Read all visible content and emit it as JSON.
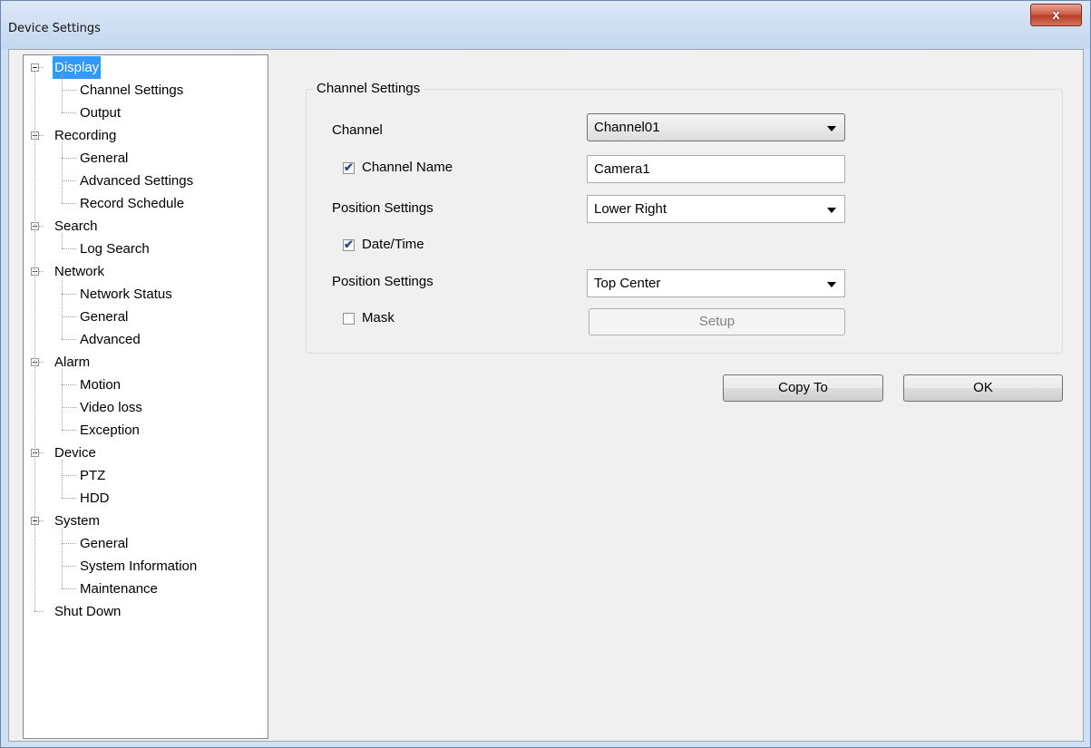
{
  "window": {
    "title": "Device Settings",
    "close_label": "x"
  },
  "tree": {
    "nodes": [
      {
        "label": "Display",
        "level": 0,
        "expanded": true,
        "selected": true
      },
      {
        "label": "Channel Settings",
        "level": 1
      },
      {
        "label": "Output",
        "level": 1
      },
      {
        "label": "Recording",
        "level": 0,
        "expanded": true
      },
      {
        "label": "General",
        "level": 1
      },
      {
        "label": "Advanced Settings",
        "level": 1
      },
      {
        "label": "Record Schedule",
        "level": 1
      },
      {
        "label": "Search",
        "level": 0,
        "expanded": true
      },
      {
        "label": "Log Search",
        "level": 1
      },
      {
        "label": "Network",
        "level": 0,
        "expanded": true
      },
      {
        "label": "Network Status",
        "level": 1
      },
      {
        "label": "General",
        "level": 1
      },
      {
        "label": "Advanced",
        "level": 1
      },
      {
        "label": "Alarm",
        "level": 0,
        "expanded": true
      },
      {
        "label": "Motion",
        "level": 1
      },
      {
        "label": "Video loss",
        "level": 1
      },
      {
        "label": "Exception",
        "level": 1
      },
      {
        "label": "Device",
        "level": 0,
        "expanded": true
      },
      {
        "label": "PTZ",
        "level": 1
      },
      {
        "label": "HDD",
        "level": 1
      },
      {
        "label": "System",
        "level": 0,
        "expanded": true
      },
      {
        "label": "General",
        "level": 1
      },
      {
        "label": "System Information",
        "level": 1
      },
      {
        "label": "Maintenance",
        "level": 1
      },
      {
        "label": "Shut Down",
        "level": 0,
        "expanded": false
      }
    ]
  },
  "channel_settings": {
    "group_title": "Channel Settings",
    "channel_label": "Channel",
    "channel_value": "Channel01",
    "channel_name_label": "Channel Name",
    "channel_name_checked": true,
    "channel_name_value": "Camera1",
    "name_position_label": "Position Settings",
    "name_position_value": "Lower Right",
    "datetime_label": "Date/Time",
    "datetime_checked": true,
    "datetime_position_label": "Position Settings",
    "datetime_position_value": "Top Center",
    "mask_label": "Mask",
    "mask_checked": false,
    "setup_label": "Setup"
  },
  "buttons": {
    "copy_to": "Copy To",
    "ok": "OK"
  },
  "colors": {
    "selection": "#3399ff",
    "window_frame": "#cfe0f3",
    "close_button": "#c95a45"
  },
  "icons": {
    "checked": "check-mark",
    "expander": "minus-box"
  }
}
